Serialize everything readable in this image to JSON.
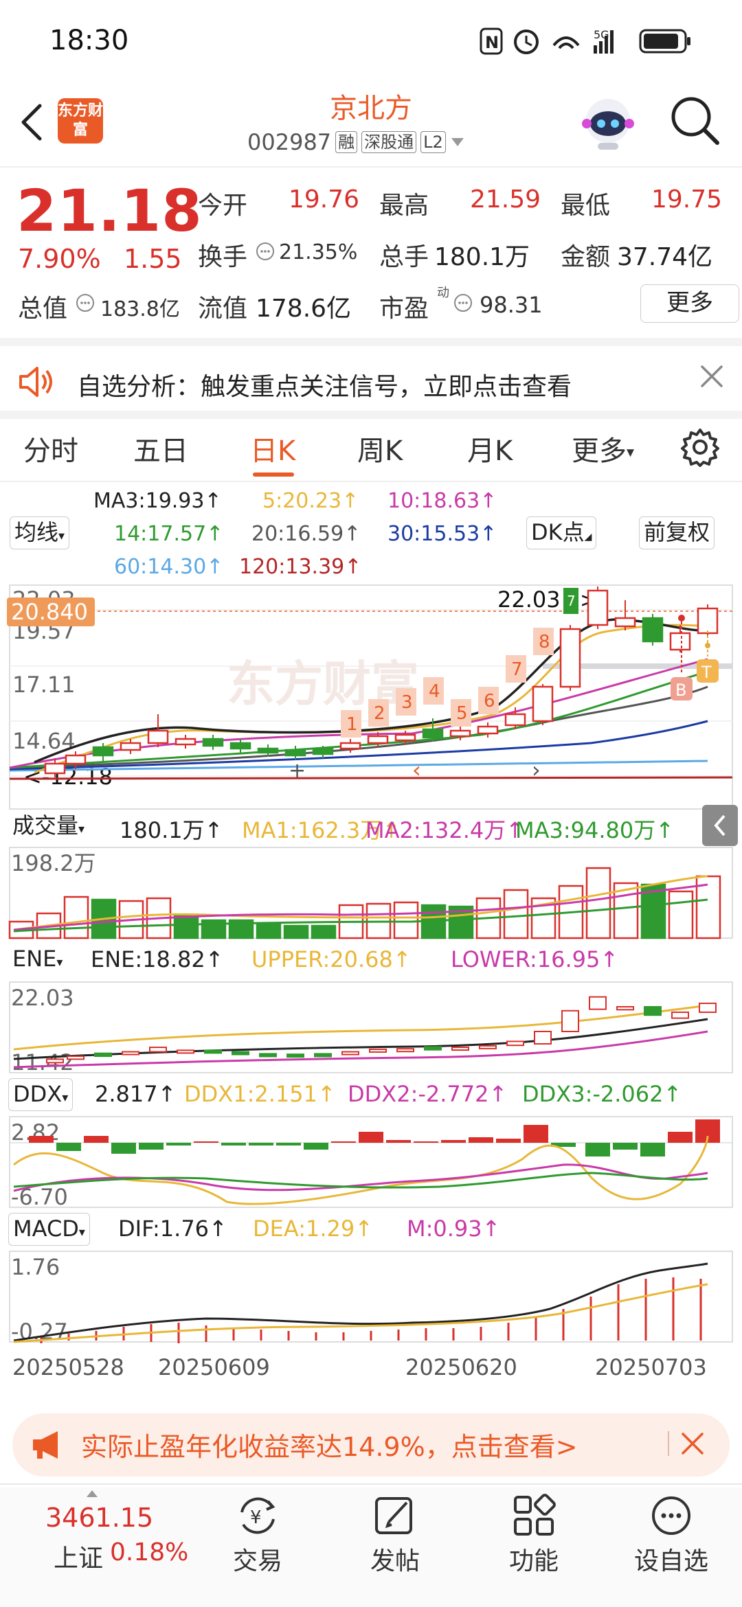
{
  "status": {
    "time": "18:30"
  },
  "header": {
    "brand": "东方财富",
    "name": "京北方",
    "code": "002987",
    "tags": [
      "融",
      "深股通",
      "L2"
    ]
  },
  "quote": {
    "price": "21.18",
    "change_pct": "7.90%",
    "change": "1.55",
    "open_label": "今开",
    "open": "19.76",
    "high_label": "最高",
    "high": "21.59",
    "low_label": "最低",
    "low": "19.75",
    "turnover_label": "换手",
    "turnover": "21.35%",
    "volume_label": "总手",
    "volume": "180.1万",
    "amount_label": "金额",
    "amount": "37.74亿",
    "mktcap_label": "总值",
    "mktcap": "183.8亿",
    "float_label": "流值",
    "float_cap": "178.6亿",
    "pe_label": "市盈",
    "pe_sup": "动",
    "pe": "98.31",
    "more": "更多"
  },
  "notice": {
    "text": "自选分析：触发重点关注信号，立即点击查看"
  },
  "tabs": [
    "分时",
    "五日",
    "日K",
    "周K",
    "月K",
    "更多"
  ],
  "active_tab": 2,
  "ma_legend": {
    "selector": "均线",
    "ma3": "MA3:19.93",
    "ma5": "5:20.23",
    "ma10": "10:18.63",
    "ma14": "14:17.57",
    "ma20": "20:16.59",
    "ma30": "30:15.53",
    "ma60": "60:14.30",
    "ma120": "120:13.39",
    "dk": "DK点",
    "fq": "前复权"
  },
  "kline": {
    "price_tag": "20.840",
    "ticks": [
      "22.03",
      "19.57",
      "17.11",
      "14.64",
      "12.18"
    ],
    "high_label": "22.03",
    "low_label": "12.18",
    "high_marker": "7",
    "count_markers": [
      "1",
      "2",
      "3",
      "4",
      "5",
      "6",
      "7",
      "8"
    ],
    "b_marker": "B",
    "t_marker": "T",
    "watermark": "东方财富"
  },
  "volume_panel": {
    "selector": "成交量",
    "value": "180.1万",
    "ma1": "MA1:162.3万",
    "ma2": "MA2:132.4万",
    "ma3": "MA3:94.80万",
    "tick": "198.2万"
  },
  "ene_panel": {
    "selector": "ENE",
    "ene": "ENE:18.82",
    "upper": "UPPER:20.68",
    "lower": "LOWER:16.95",
    "tick_top": "22.03",
    "tick_bottom": "11.42"
  },
  "ddx_panel": {
    "selector": "DDX",
    "ddx": "2.817",
    "ddx1": "DDX1:2.151",
    "ddx2": "DDX2:-2.772",
    "ddx3": "DDX3:-2.062",
    "tick_top": "2.82",
    "tick_bottom": "-6.70"
  },
  "macd_panel": {
    "selector": "MACD",
    "dif": "DIF:1.76",
    "dea": "DEA:1.29",
    "m": "M:0.93",
    "tick_top": "1.76",
    "tick_bottom": "-0.27"
  },
  "dates": [
    "20250528",
    "20250609",
    "20250620",
    "20250703"
  ],
  "promo": {
    "text": "实际止盈年化收益率达14.9%，点击查看>"
  },
  "bottom_nav": {
    "index_value": "3461.15",
    "index_name": "上证",
    "index_pct": "0.18%",
    "items": [
      "交易",
      "发帖",
      "功能",
      "设自选"
    ]
  },
  "colors": {
    "up": "#d9302b",
    "down": "#2f9a2f",
    "accent": "#ea5a26"
  }
}
